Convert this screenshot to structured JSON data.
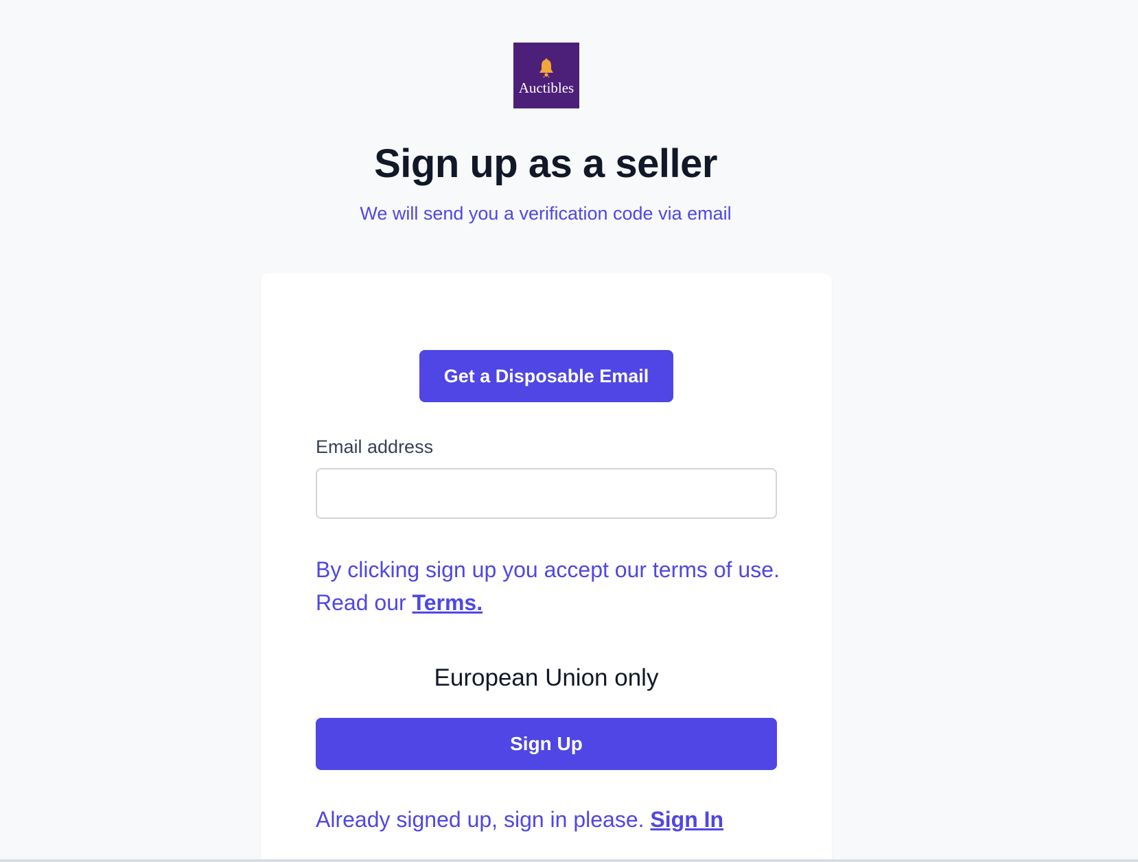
{
  "brand": {
    "logo_text": "Auctibles",
    "logo_bg_color": "#4c1f78",
    "bell_color": "#f0a83a"
  },
  "header": {
    "title": "Sign up as a seller",
    "subtitle": "We will send you a verification code via email"
  },
  "form": {
    "disposable_button_label": "Get a Disposable Email",
    "email_label": "Email address",
    "email_value": "",
    "email_placeholder": "",
    "terms_text": "By clicking sign up you accept our terms of use. Read our ",
    "terms_link": "Terms.",
    "region_note": "European Union only",
    "signup_button_label": "Sign Up",
    "signin_prompt": "Already signed up, sign in please. ",
    "signin_link": "Sign In"
  },
  "colors": {
    "accent": "#4f46e5",
    "page_bg": "#f8f9fb",
    "heading": "#111827"
  }
}
